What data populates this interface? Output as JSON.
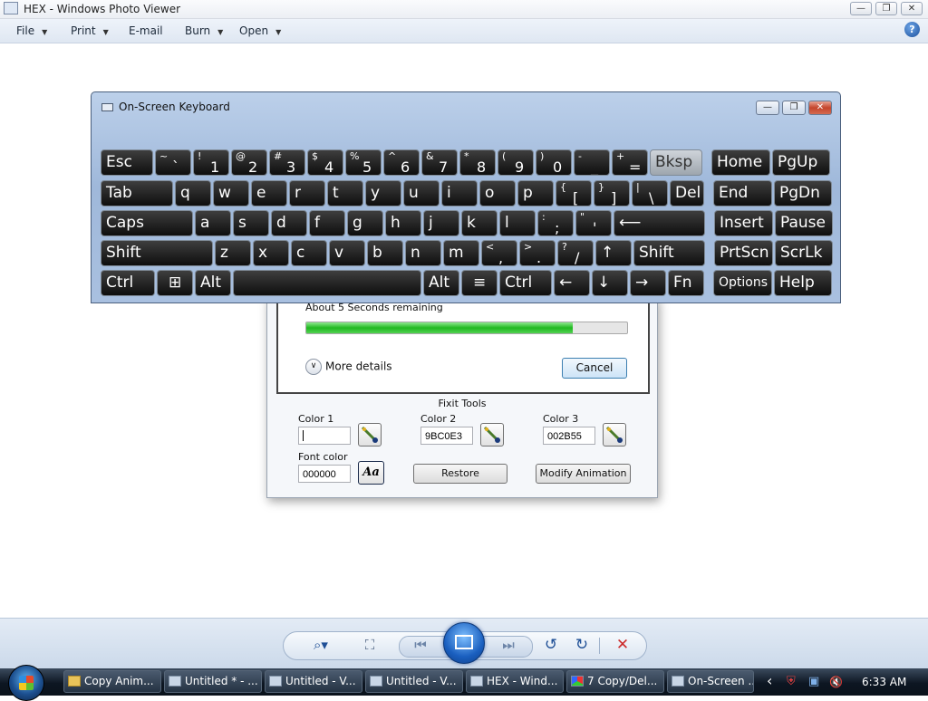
{
  "window": {
    "title": "HEX - Windows Photo Viewer",
    "controls": {
      "minimize": "—",
      "restore": "❐",
      "close": "✕"
    }
  },
  "menubar": {
    "items": [
      {
        "label": "File",
        "has_arrow": true
      },
      {
        "label": "Print",
        "has_arrow": true
      },
      {
        "label": "E-mail",
        "has_arrow": false
      },
      {
        "label": "Burn",
        "has_arrow": true
      },
      {
        "label": "Open",
        "has_arrow": true
      }
    ],
    "arrow_glyph": "▼",
    "help_glyph": "?"
  },
  "keyboard": {
    "title": "On-Screen Keyboard",
    "controls": {
      "minimize": "—",
      "restore": "❐",
      "close": "✕"
    },
    "rows": [
      [
        {
          "main": "Esc",
          "w": 58
        },
        {
          "top": "~",
          "bottom": "`",
          "w": 40
        },
        {
          "top": "!",
          "bottom": "1",
          "w": 40
        },
        {
          "top": "@",
          "bottom": "2",
          "w": 40
        },
        {
          "top": "#",
          "bottom": "3",
          "w": 40
        },
        {
          "top": "$",
          "bottom": "4",
          "w": 40
        },
        {
          "top": "%",
          "bottom": "5",
          "w": 40
        },
        {
          "top": "^",
          "bottom": "6",
          "w": 40
        },
        {
          "top": "&",
          "bottom": "7",
          "w": 40
        },
        {
          "top": "*",
          "bottom": "8",
          "w": 40
        },
        {
          "top": "(",
          "bottom": "9",
          "w": 40
        },
        {
          "top": ")",
          "bottom": "0",
          "w": 40
        },
        {
          "top": "-",
          "bottom": "_",
          "w": 40
        },
        {
          "top": "+",
          "bottom": "=",
          "w": 40
        },
        {
          "main": "Bksp",
          "w": 58,
          "active": true
        },
        {
          "main": "Home",
          "w": 65,
          "gap": 8
        },
        {
          "main": "PgUp",
          "w": 64
        }
      ],
      [
        {
          "main": "Tab",
          "w": 80
        },
        {
          "main": "q",
          "w": 40
        },
        {
          "main": "w",
          "w": 40
        },
        {
          "main": "e",
          "w": 40
        },
        {
          "main": "r",
          "w": 40
        },
        {
          "main": "t",
          "w": 40
        },
        {
          "main": "y",
          "w": 40
        },
        {
          "main": "u",
          "w": 40
        },
        {
          "main": "i",
          "w": 40
        },
        {
          "main": "o",
          "w": 40
        },
        {
          "main": "p",
          "w": 40
        },
        {
          "top": "{",
          "bottom": "[",
          "w": 40
        },
        {
          "top": "}",
          "bottom": "]",
          "w": 40
        },
        {
          "top": "|",
          "bottom": "\\",
          "w": 40
        },
        {
          "main": "Del",
          "w": 38
        },
        {
          "main": "End",
          "w": 65,
          "gap": 8
        },
        {
          "main": "PgDn",
          "w": 64
        }
      ],
      [
        {
          "main": "Caps",
          "w": 102
        },
        {
          "main": "a",
          "w": 40
        },
        {
          "main": "s",
          "w": 40
        },
        {
          "main": "d",
          "w": 40
        },
        {
          "main": "f",
          "w": 40
        },
        {
          "main": "g",
          "w": 40
        },
        {
          "main": "h",
          "w": 40
        },
        {
          "main": "j",
          "w": 40
        },
        {
          "main": "k",
          "w": 40
        },
        {
          "main": "l",
          "w": 40
        },
        {
          "top": ":",
          "bottom": ";",
          "w": 40
        },
        {
          "top": "\"",
          "bottom": "'",
          "w": 40
        },
        {
          "main": "⟵",
          "w": 101
        },
        {
          "main": "Insert",
          "w": 65,
          "gap": 8
        },
        {
          "main": "Pause",
          "w": 64
        }
      ],
      [
        {
          "main": "Shift",
          "w": 124
        },
        {
          "main": "z",
          "w": 40
        },
        {
          "main": "x",
          "w": 40
        },
        {
          "main": "c",
          "w": 40
        },
        {
          "main": "v",
          "w": 40
        },
        {
          "main": "b",
          "w": 40
        },
        {
          "main": "n",
          "w": 40
        },
        {
          "main": "m",
          "w": 40
        },
        {
          "top": "<",
          "bottom": ",",
          "w": 40
        },
        {
          "top": ">",
          "bottom": ".",
          "w": 40
        },
        {
          "top": "?",
          "bottom": "/",
          "w": 40
        },
        {
          "main": "↑",
          "w": 40
        },
        {
          "main": "Shift",
          "w": 79
        },
        {
          "main": "PrtScn",
          "w": 65,
          "gap": 8
        },
        {
          "main": "ScrLk",
          "w": 64
        }
      ],
      [
        {
          "main": "Ctrl",
          "w": 60
        },
        {
          "icon": "windows-icon",
          "glyph": "⊞",
          "w": 40
        },
        {
          "main": "Alt",
          "w": 40
        },
        {
          "main": "",
          "w": 208
        },
        {
          "main": "Alt",
          "w": 40
        },
        {
          "icon": "menu-icon",
          "glyph": "≡",
          "w": 40
        },
        {
          "main": "Ctrl",
          "w": 58
        },
        {
          "main": "←",
          "w": 40
        },
        {
          "main": "↓",
          "w": 40
        },
        {
          "main": "→",
          "w": 40
        },
        {
          "main": "Fn",
          "w": 40
        },
        {
          "main": "Options",
          "w": 65,
          "gap": 8,
          "small": true
        },
        {
          "main": "Help",
          "w": 64
        }
      ]
    ]
  },
  "progress_dialog": {
    "status_text": "About 5 Seconds remaining",
    "progress_fraction": 0.83,
    "more_details_label": "More details",
    "more_details_glyph": "∨",
    "cancel_label": "Cancel"
  },
  "fixit_tools": {
    "title": "Fixit Tools",
    "color1_label": "Color 1",
    "color1_value": "",
    "color2_label": "Color 2",
    "color2_value": "9BC0E3",
    "color3_label": "Color 3",
    "color3_value": "002B55",
    "font_color_label": "Font color",
    "font_color_value": "000000",
    "font_button_label": "Aa",
    "restore_label": "Restore",
    "modify_animation_label": "Modify Animation"
  },
  "viewer_controls": {
    "zoom_glyph": "⌕▾",
    "fit_glyph": "⛶",
    "prev_glyph": "⏮",
    "next_glyph": "⏭",
    "rotate_ccw_glyph": "↺",
    "rotate_cw_glyph": "↻",
    "delete_glyph": "✕"
  },
  "taskbar": {
    "buttons": [
      {
        "label": "Copy Anim...",
        "icon": "folder"
      },
      {
        "label": "Untitled * - ...",
        "icon": "window"
      },
      {
        "label": "Untitled - V...",
        "icon": "window"
      },
      {
        "label": "Untitled - V...",
        "icon": "window"
      },
      {
        "label": "HEX - Wind...",
        "icon": "window"
      },
      {
        "label": "7 Copy/Del...",
        "icon": "color"
      },
      {
        "label": "On-Screen ...",
        "icon": "window"
      }
    ],
    "tray_glyphs": {
      "chevron": "‹",
      "shield": "⛨",
      "network": "▣",
      "volume": "🔇"
    },
    "clock": "6:33 AM"
  },
  "colors": {
    "progress": "#1fb81f",
    "key_face": "#111111",
    "osk_frame": "#a9c0e0",
    "taskbar": "#0d1622",
    "accent": "#1f4f96",
    "delete": "#cc2a2a"
  }
}
